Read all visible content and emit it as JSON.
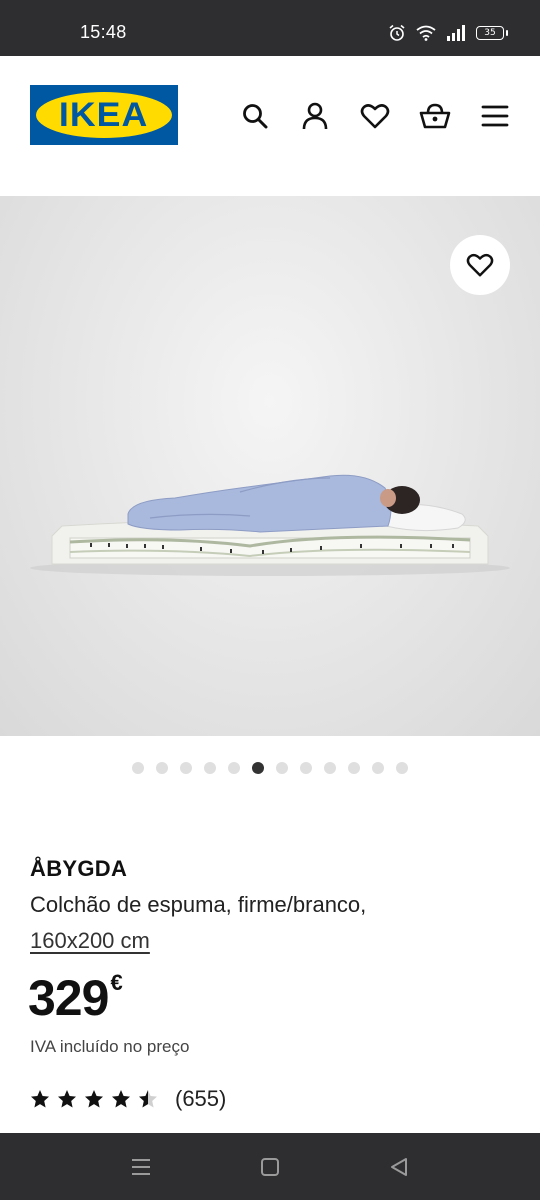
{
  "status_bar": {
    "time": "15:48",
    "battery": "35",
    "icons": [
      "alarm-icon",
      "wifi-icon",
      "signal-icon",
      "battery-icon"
    ]
  },
  "header": {
    "logo_text": "IKEA",
    "icons": [
      "search-icon",
      "account-icon",
      "heart-icon",
      "basket-icon",
      "menu-icon"
    ],
    "colors": {
      "logo_blue": "#0058a3",
      "logo_yellow": "#ffdb00"
    }
  },
  "gallery": {
    "total_images": 12,
    "active_index": 5,
    "favorite_icon": "heart-icon"
  },
  "product": {
    "name": "ÅBYGDA",
    "description": "Colchão de espuma, firme/branco,",
    "size": "160x200 cm",
    "price": "329",
    "currency": "€",
    "vat_note": "IVA incluído no preço",
    "rating": 4.5,
    "review_count": "(655)"
  },
  "nav_bar": {
    "icons": [
      "recents-icon",
      "home-icon",
      "back-icon"
    ]
  }
}
